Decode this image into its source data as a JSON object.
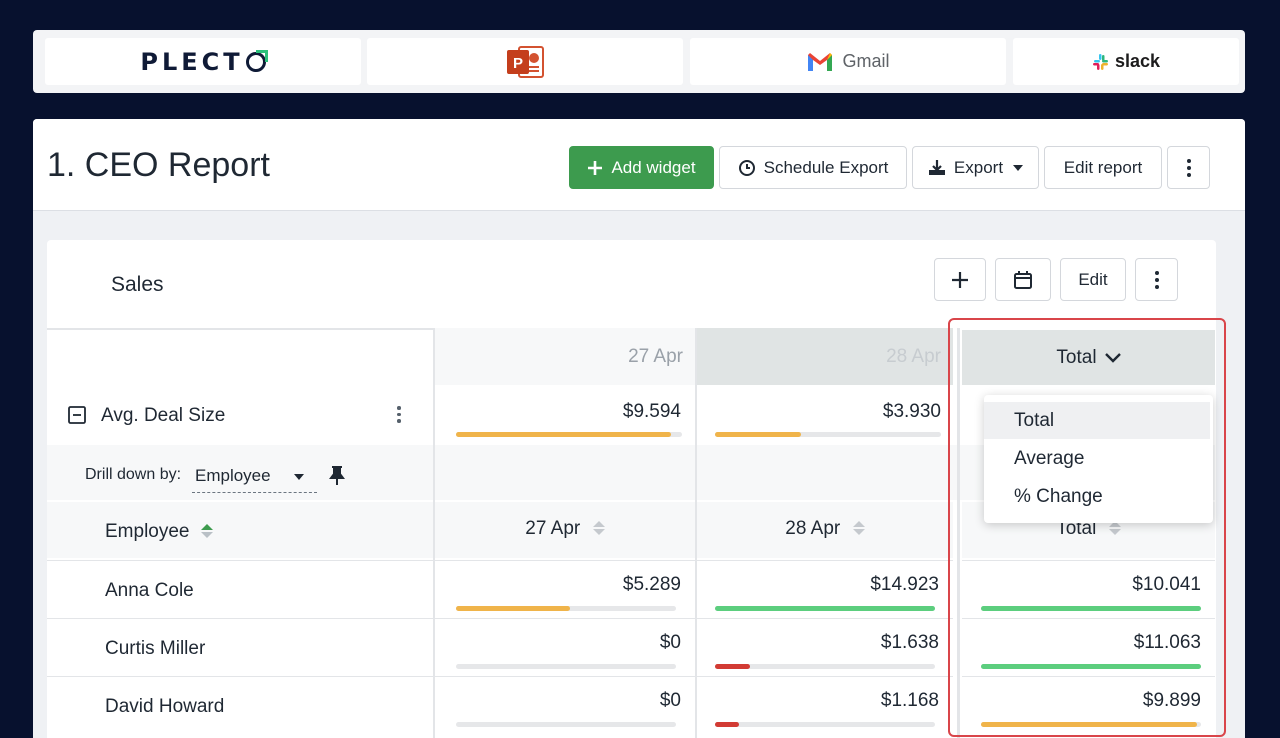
{
  "integrations": {
    "plecto": "PLECTO",
    "gmail": "Gmail",
    "slack": "slack"
  },
  "header": {
    "title": "1. CEO Report",
    "add_widget": "Add widget",
    "schedule_export": "Schedule Export",
    "export": "Export",
    "edit_report": "Edit report"
  },
  "widget": {
    "title": "Sales",
    "edit": "Edit",
    "columns": {
      "date1": "27 Apr",
      "date2": "28 Apr",
      "total": "Total"
    },
    "metric": {
      "label": "Avg. Deal Size",
      "values": [
        "$9.594",
        "$3.930"
      ],
      "fills": [
        0.95,
        0.38
      ]
    },
    "drilldown": {
      "label": "Drill down by:",
      "value": "Employee"
    },
    "sub_header": {
      "employee": "Employee",
      "date1": "27 Apr",
      "date2": "28 Apr",
      "total": "Total"
    },
    "rows": [
      {
        "name": "Anna Cole",
        "d1": "$5.289",
        "d2": "$14.923",
        "total": "$10.041"
      },
      {
        "name": "Curtis Miller",
        "d1": "$0",
        "d2": "$1.638",
        "total": "$11.063"
      },
      {
        "name": "David Howard",
        "d1": "$0",
        "d2": "$1.168",
        "total": "$9.899"
      }
    ],
    "row_fills": [
      {
        "d1": 0.52,
        "d2": 1.0,
        "total": 1.0
      },
      {
        "d1": 0.0,
        "d2": 0.16,
        "total": 1.0
      },
      {
        "d1": 0.0,
        "d2": 0.11,
        "total": 0.98
      }
    ]
  },
  "dropdown": {
    "items": [
      "Total",
      "Average",
      "% Change"
    ]
  },
  "colors": {
    "green": "#3d9b4e",
    "bar_yellow": "#f0b44a",
    "bar_green": "#5cce7e",
    "bar_red": "#d23b34",
    "highlight": "#d9454a"
  }
}
